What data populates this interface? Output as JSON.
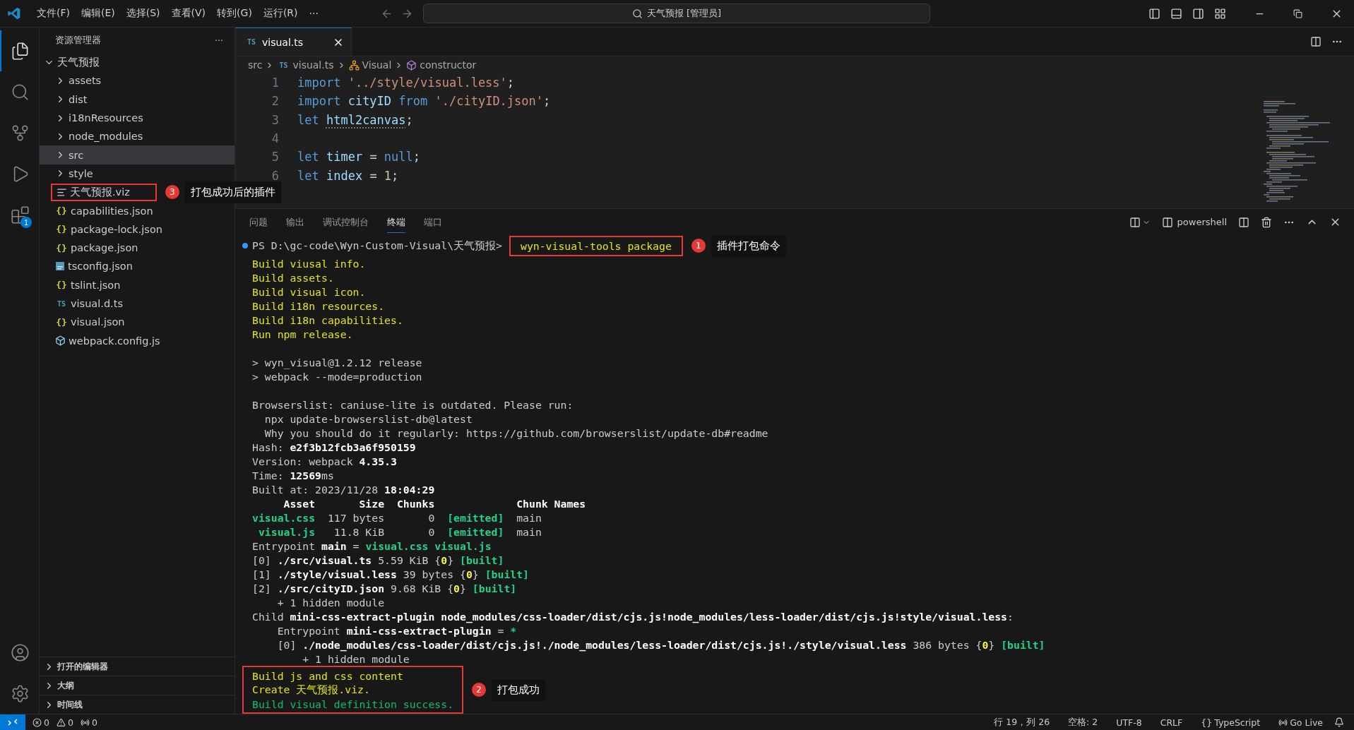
{
  "title_bar": {
    "menus": [
      "文件(F)",
      "编辑(E)",
      "选择(S)",
      "查看(V)",
      "转到(G)",
      "运行(R)"
    ],
    "more": "···",
    "search": "天气预报 [管理员]"
  },
  "activity_bar": {
    "items": [
      {
        "kind": "files",
        "selected": true
      },
      {
        "kind": "search",
        "selected": false
      },
      {
        "kind": "source-control",
        "selected": false
      },
      {
        "kind": "run-debug",
        "selected": false
      },
      {
        "kind": "extensions",
        "selected": false,
        "badge": "1"
      }
    ],
    "bottom": [
      {
        "kind": "account"
      },
      {
        "kind": "settings"
      }
    ]
  },
  "sidebar": {
    "title": "资源管理器",
    "more": "···",
    "tree": {
      "label": "天气预报",
      "kind": "folder",
      "expanded": true,
      "selected": false,
      "children": [
        {
          "label": "assets",
          "kind": "folder",
          "expanded": false,
          "selected": false
        },
        {
          "label": "dist",
          "kind": "folder",
          "expanded": false,
          "selected": false
        },
        {
          "label": "i18nResources",
          "kind": "folder",
          "expanded": false,
          "selected": false
        },
        {
          "label": "node_modules",
          "kind": "folder",
          "expanded": false,
          "selected": false
        },
        {
          "label": "src",
          "kind": "folder",
          "expanded": false,
          "selected": true
        },
        {
          "label": "style",
          "kind": "folder",
          "expanded": false,
          "selected": false
        },
        {
          "label": "天气预报.viz",
          "kind": "viz",
          "selected": false,
          "annotation": {
            "number": "3",
            "label": "打包成功后的插件"
          }
        },
        {
          "label": "capabilities.json",
          "kind": "json",
          "icon_text": "{}",
          "selected": false
        },
        {
          "label": "package-lock.json",
          "kind": "json",
          "icon_text": "{}",
          "selected": false
        },
        {
          "label": "package.json",
          "kind": "json",
          "icon_text": "{}",
          "selected": false
        },
        {
          "label": "tsconfig.json",
          "kind": "tsconfig",
          "selected": false
        },
        {
          "label": "tslint.json",
          "kind": "json",
          "icon_text": "{}",
          "selected": false
        },
        {
          "label": "visual.d.ts",
          "kind": "ts",
          "icon_text": "TS",
          "selected": false
        },
        {
          "label": "visual.json",
          "kind": "json",
          "icon_text": "{}",
          "selected": false
        },
        {
          "label": "webpack.config.js",
          "kind": "webpack",
          "selected": false
        }
      ]
    },
    "sections": [
      {
        "label": "打开的编辑器",
        "expanded": false
      },
      {
        "label": "大纲",
        "expanded": false
      },
      {
        "label": "时间线",
        "expanded": false
      }
    ]
  },
  "editor": {
    "tabs": [
      {
        "icon_text": "TS",
        "label": "visual.ts",
        "selected": true
      }
    ],
    "breadcrumb": [
      {
        "kind": "folder",
        "label": "src"
      },
      {
        "kind": "file",
        "icon_text": "TS",
        "label": "visual.ts"
      },
      {
        "kind": "class",
        "label": "Visual"
      },
      {
        "kind": "method",
        "label": "constructor"
      }
    ],
    "lines": [
      {
        "number": "1",
        "tokens": [
          {
            "text": "import ",
            "color": "#569cd6"
          },
          {
            "text": "'../style/visual.less'",
            "color": "#ce9178"
          },
          {
            "text": ";",
            "color": "#cccccc"
          }
        ]
      },
      {
        "number": "2",
        "tokens": [
          {
            "text": "import ",
            "color": "#569cd6"
          },
          {
            "text": "cityID ",
            "color": "#9cdcfe"
          },
          {
            "text": "from ",
            "color": "#569cd6"
          },
          {
            "text": "'./cityID.json'",
            "color": "#ce9178"
          },
          {
            "text": ";",
            "color": "#cccccc"
          }
        ]
      },
      {
        "number": "3",
        "tokens": [
          {
            "text": "let ",
            "color": "#569cd6"
          },
          {
            "text": "html2canvas",
            "color": "#9cdcfe",
            "hint": true
          },
          {
            "text": ";",
            "color": "#cccccc"
          }
        ]
      },
      {
        "number": "4"
      },
      {
        "number": "5",
        "tokens": [
          {
            "text": "let ",
            "color": "#569cd6"
          },
          {
            "text": "timer",
            "color": "#9cdcfe"
          },
          {
            "text": " = ",
            "color": "#cccccc"
          },
          {
            "text": "null",
            "color": "#569cd6"
          },
          {
            "text": ";",
            "color": "#cccccc"
          }
        ]
      },
      {
        "number": "6",
        "tokens": [
          {
            "text": "let ",
            "color": "#569cd6"
          },
          {
            "text": "index",
            "color": "#9cdcfe"
          },
          {
            "text": " = ",
            "color": "#cccccc"
          },
          {
            "text": "1",
            "color": "#b5cea8"
          },
          {
            "text": ";",
            "color": "#cccccc"
          }
        ]
      }
    ]
  },
  "panel": {
    "tabs": [
      {
        "label": "问题",
        "selected": false
      },
      {
        "label": "输出",
        "selected": false
      },
      {
        "label": "调试控制台",
        "selected": false
      },
      {
        "label": "终端",
        "selected": true
      },
      {
        "label": "端口",
        "selected": false
      }
    ],
    "shell": "powershell",
    "terminal": [
      {
        "kind": "prompt",
        "prompt": "PS D:\\gc-code\\Wyn-Custom-Visual\\天气预报>",
        "command": "wyn-visual-tools package",
        "annotation": {
          "number": "1",
          "label": "插件打包命令"
        }
      },
      {
        "kind": "output",
        "segments": [
          {
            "text": "Build viusal info.",
            "color": "#e5e510",
            "bold": false
          }
        ]
      },
      {
        "kind": "output",
        "segments": [
          {
            "text": "Build assets.",
            "color": "#e5e510",
            "bold": false
          }
        ]
      },
      {
        "kind": "output",
        "segments": [
          {
            "text": "Build visual icon.",
            "color": "#e5e510",
            "bold": false
          }
        ]
      },
      {
        "kind": "output",
        "segments": [
          {
            "text": "Build i18n resources.",
            "color": "#e5e510",
            "bold": false
          }
        ]
      },
      {
        "kind": "output",
        "segments": [
          {
            "text": "Build i18n capabilities.",
            "color": "#e5e510",
            "bold": false
          }
        ]
      },
      {
        "kind": "output",
        "segments": [
          {
            "text": "Run npm release.",
            "color": "#e5e510",
            "bold": false
          }
        ]
      },
      {
        "kind": "blank"
      },
      {
        "kind": "output",
        "segments": [
          {
            "text": "> wyn_visual@1.2.12 release",
            "color": "#cccccc",
            "bold": false
          }
        ]
      },
      {
        "kind": "output",
        "segments": [
          {
            "text": "> webpack --mode=production",
            "color": "#cccccc",
            "bold": false
          }
        ]
      },
      {
        "kind": "blank"
      },
      {
        "kind": "output",
        "segments": [
          {
            "text": "Browserslist: caniuse-lite is outdated. Please run:",
            "color": "#cccccc",
            "bold": false
          }
        ]
      },
      {
        "kind": "output",
        "segments": [
          {
            "text": "  npx update-browserslist-db@latest",
            "color": "#cccccc",
            "bold": false
          }
        ]
      },
      {
        "kind": "output",
        "segments": [
          {
            "text": "  Why you should do it regularly: https://github.com/browserslist/update-db#readme",
            "color": "#cccccc",
            "bold": false
          }
        ]
      },
      {
        "kind": "output",
        "segments": [
          {
            "text": "Hash: ",
            "color": "#cccccc",
            "bold": false
          },
          {
            "text": "e2f3b12fcb3a6f950159",
            "color": "#ffffff",
            "bold": true
          }
        ]
      },
      {
        "kind": "output",
        "segments": [
          {
            "text": "Version: webpack ",
            "color": "#cccccc",
            "bold": false
          },
          {
            "text": "4.35.3",
            "color": "#ffffff",
            "bold": true
          }
        ]
      },
      {
        "kind": "output",
        "segments": [
          {
            "text": "Time: ",
            "color": "#cccccc",
            "bold": false
          },
          {
            "text": "12569",
            "color": "#ffffff",
            "bold": true
          },
          {
            "text": "ms",
            "color": "#cccccc",
            "bold": false
          }
        ]
      },
      {
        "kind": "output",
        "segments": [
          {
            "text": "Built at: 2023/11/28 ",
            "color": "#cccccc",
            "bold": false
          },
          {
            "text": "18:04:29",
            "color": "#ffffff",
            "bold": true
          }
        ]
      },
      {
        "kind": "output",
        "segments": [
          {
            "text": "     Asset       Size  Chunks             Chunk Names",
            "color": "#ffffff",
            "bold": true
          }
        ]
      },
      {
        "kind": "output",
        "segments": [
          {
            "text": "visual.css",
            "color": "#23d18b",
            "bold": true
          },
          {
            "text": "  117 bytes       0  ",
            "color": "#cccccc",
            "bold": false
          },
          {
            "text": "[emitted]",
            "color": "#23d18b",
            "bold": true
          },
          {
            "text": "  main",
            "color": "#cccccc",
            "bold": false
          }
        ]
      },
      {
        "kind": "output",
        "segments": [
          {
            "text": " visual.js",
            "color": "#23d18b",
            "bold": true
          },
          {
            "text": "   11.8 KiB       0  ",
            "color": "#cccccc",
            "bold": false
          },
          {
            "text": "[emitted]",
            "color": "#23d18b",
            "bold": true
          },
          {
            "text": "  main",
            "color": "#cccccc",
            "bold": false
          }
        ]
      },
      {
        "kind": "output",
        "segments": [
          {
            "text": "Entrypoint ",
            "color": "#cccccc",
            "bold": false
          },
          {
            "text": "main",
            "color": "#ffffff",
            "bold": true
          },
          {
            "text": " = ",
            "color": "#cccccc",
            "bold": false
          },
          {
            "text": "visual.css visual.js",
            "color": "#23d18b",
            "bold": true
          }
        ]
      },
      {
        "kind": "output",
        "segments": [
          {
            "text": "[0] ",
            "color": "#cccccc",
            "bold": false
          },
          {
            "text": "./src/visual.ts",
            "color": "#ffffff",
            "bold": true
          },
          {
            "text": " 5.59 KiB {",
            "color": "#cccccc",
            "bold": false
          },
          {
            "text": "0",
            "color": "#f5f543",
            "bold": true
          },
          {
            "text": "} ",
            "color": "#cccccc",
            "bold": false
          },
          {
            "text": "[built]",
            "color": "#23d18b",
            "bold": true
          }
        ]
      },
      {
        "kind": "output",
        "segments": [
          {
            "text": "[1] ",
            "color": "#cccccc",
            "bold": false
          },
          {
            "text": "./style/visual.less",
            "color": "#ffffff",
            "bold": true
          },
          {
            "text": " 39 bytes {",
            "color": "#cccccc",
            "bold": false
          },
          {
            "text": "0",
            "color": "#f5f543",
            "bold": true
          },
          {
            "text": "} ",
            "color": "#cccccc",
            "bold": false
          },
          {
            "text": "[built]",
            "color": "#23d18b",
            "bold": true
          }
        ]
      },
      {
        "kind": "output",
        "segments": [
          {
            "text": "[2] ",
            "color": "#cccccc",
            "bold": false
          },
          {
            "text": "./src/cityID.json",
            "color": "#ffffff",
            "bold": true
          },
          {
            "text": " 9.68 KiB {",
            "color": "#cccccc",
            "bold": false
          },
          {
            "text": "0",
            "color": "#f5f543",
            "bold": true
          },
          {
            "text": "} ",
            "color": "#cccccc",
            "bold": false
          },
          {
            "text": "[built]",
            "color": "#23d18b",
            "bold": true
          }
        ]
      },
      {
        "kind": "output",
        "segments": [
          {
            "text": "    + 1 hidden module",
            "color": "#cccccc",
            "bold": false
          }
        ]
      },
      {
        "kind": "output",
        "segments": [
          {
            "text": "Child ",
            "color": "#cccccc",
            "bold": false
          },
          {
            "text": "mini-css-extract-plugin node_modules/css-loader/dist/cjs.js!node_modules/less-loader/dist/cjs.js!style/visual.less",
            "color": "#ffffff",
            "bold": true
          },
          {
            "text": ":",
            "color": "#cccccc",
            "bold": false
          }
        ]
      },
      {
        "kind": "output",
        "segments": [
          {
            "text": "    Entrypoint ",
            "color": "#cccccc",
            "bold": false
          },
          {
            "text": "mini-css-extract-plugin",
            "color": "#ffffff",
            "bold": true
          },
          {
            "text": " = ",
            "color": "#cccccc",
            "bold": false
          },
          {
            "text": "*",
            "color": "#23d18b",
            "bold": true
          }
        ]
      },
      {
        "kind": "output",
        "segments": [
          {
            "text": "    [0] ",
            "color": "#cccccc",
            "bold": false
          },
          {
            "text": "./node_modules/css-loader/dist/cjs.js!./node_modules/less-loader/dist/cjs.js!./style/visual.less",
            "color": "#ffffff",
            "bold": true
          },
          {
            "text": " 386 bytes {",
            "color": "#cccccc",
            "bold": false
          },
          {
            "text": "0",
            "color": "#f5f543",
            "bold": true
          },
          {
            "text": "} ",
            "color": "#cccccc",
            "bold": false
          },
          {
            "text": "[built]",
            "color": "#23d18b",
            "bold": true
          }
        ]
      },
      {
        "kind": "output",
        "segments": [
          {
            "text": "        + 1 hidden module",
            "color": "#cccccc",
            "bold": false
          }
        ]
      },
      {
        "kind": "group",
        "annotation": {
          "number": "2",
          "label": "打包成功"
        },
        "lines": [
          {
            "segments": [
              {
                "text": "Build js and css content",
                "color": "#e5e510",
                "bold": false
              }
            ]
          },
          {
            "segments": [
              {
                "text": "Create 天气预报.viz.",
                "color": "#e5e510",
                "bold": false
              }
            ]
          },
          {
            "segments": [
              {
                "text": "Build visual definition success.",
                "color": "#0dbc79",
                "bold": false
              }
            ]
          }
        ]
      }
    ]
  },
  "status_bar": {
    "left": [
      {
        "kind": "error",
        "text": "0"
      },
      {
        "kind": "warning",
        "text": "0"
      },
      {
        "kind": "ports",
        "text": "0"
      }
    ],
    "right": [
      {
        "text": "行 19，列 26"
      },
      {
        "text": "空格: 2"
      },
      {
        "text": "UTF-8"
      },
      {
        "text": "CRLF"
      },
      {
        "text": "TypeScript",
        "icon_text": "{}"
      },
      {
        "text": "Go Live",
        "kind": "broadcast"
      }
    ]
  }
}
